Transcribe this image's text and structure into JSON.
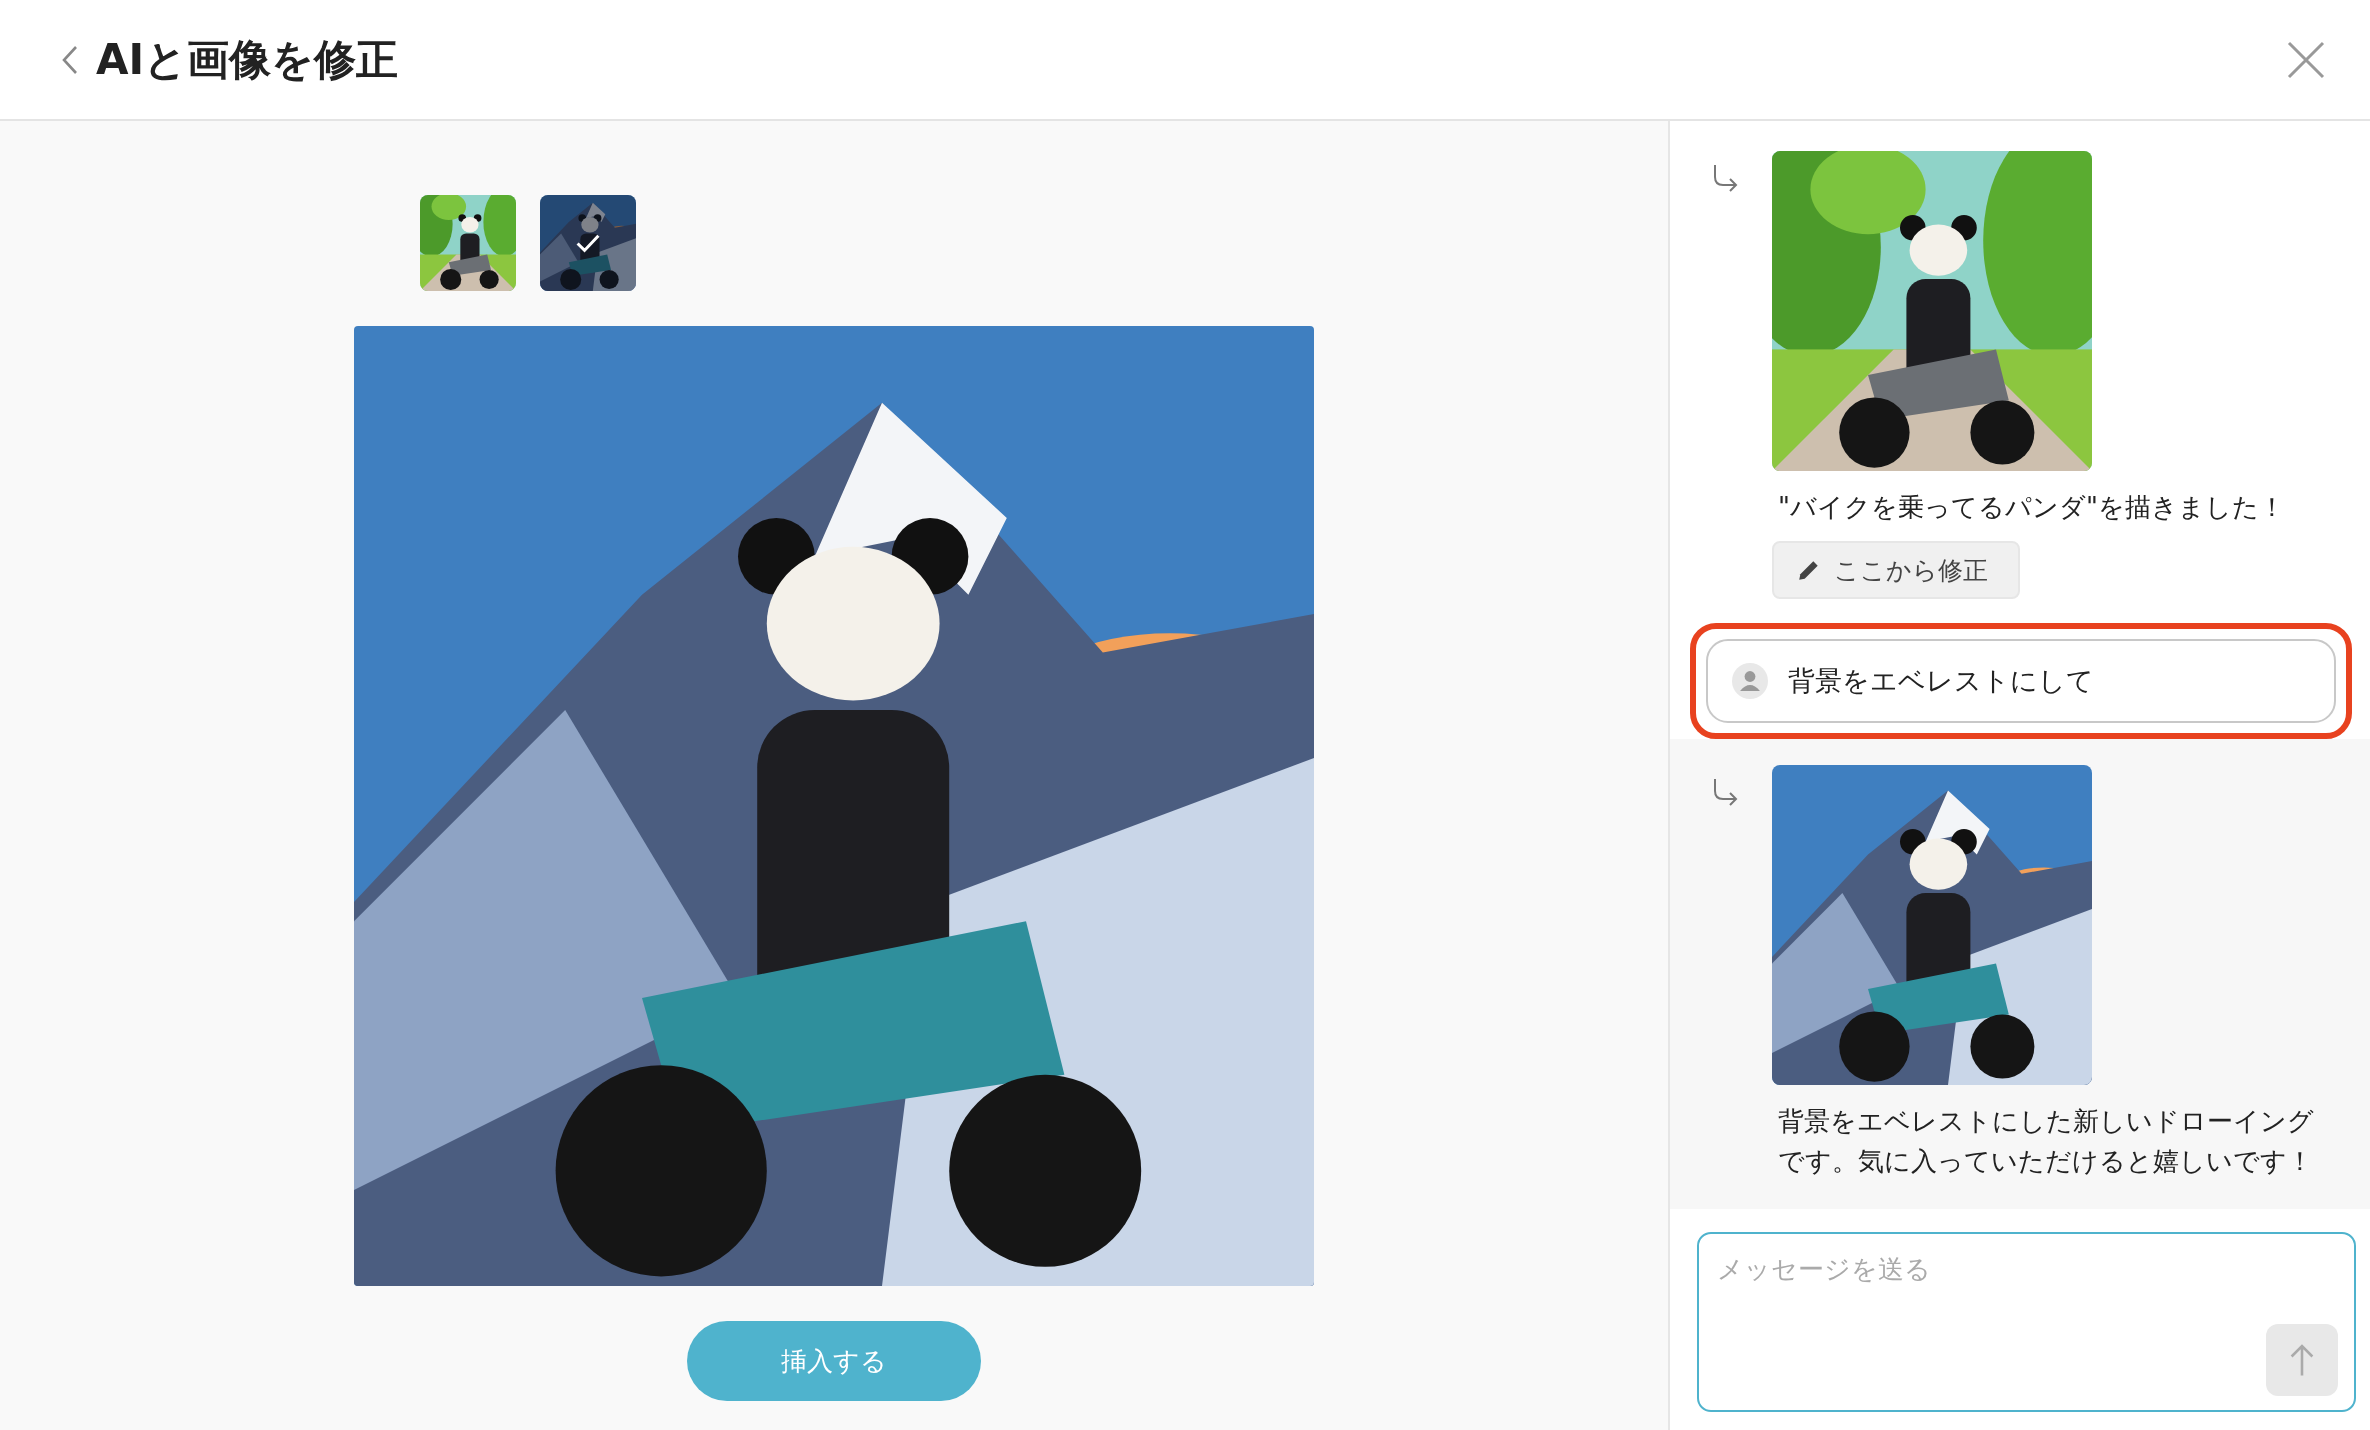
{
  "header": {
    "title": "AIと画像を修正"
  },
  "thumbnails": [
    {
      "kind": "picture",
      "selected": false
    },
    {
      "kind": "picture",
      "selected": true
    }
  ],
  "preview": {
    "kind": "picture"
  },
  "insert_button": "挿入する",
  "messages": [
    {
      "kind": "ai",
      "selected": false,
      "image": {
        "kind": "picture"
      },
      "text": "\"バイクを乗ってるパンダ\"を描きました！",
      "action": "ここから修正"
    },
    {
      "kind": "user",
      "highlighted": true,
      "text": "背景をエベレストにして"
    },
    {
      "kind": "ai",
      "selected": true,
      "image": {
        "kind": "picture"
      },
      "text": "背景をエベレストにした新しいドローイングです。気に入っていただけると嬉しいです！"
    }
  ],
  "composer": {
    "placeholder": "メッセージを送る"
  }
}
